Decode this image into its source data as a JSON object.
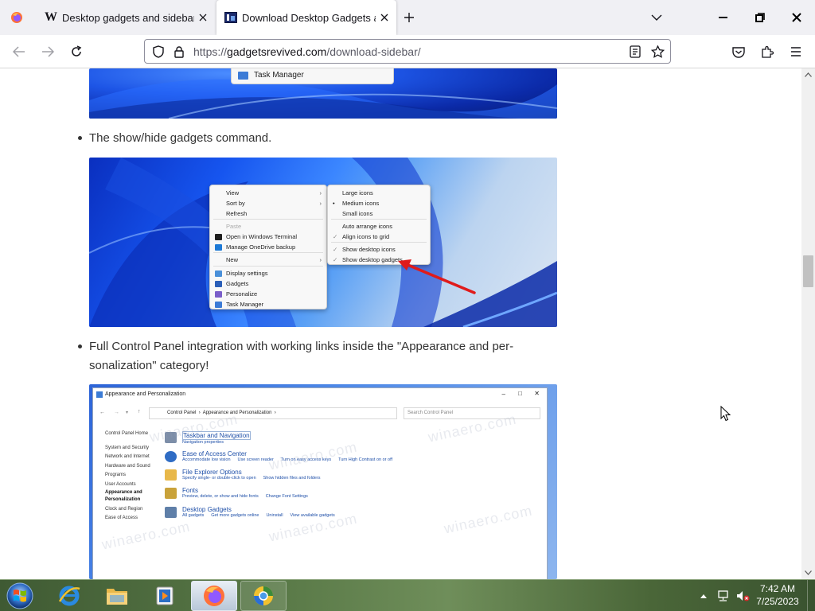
{
  "browser": {
    "tabs": [
      {
        "title": "Desktop gadgets and sidebar fo",
        "favicon": "W"
      },
      {
        "title": "Download Desktop Gadgets an"
      }
    ],
    "url_prefix": "https://",
    "url_host": "gadgetsrevived.com",
    "url_path": "/download-sidebar/"
  },
  "article": {
    "menu_top": {
      "task_manager": "Task Manager"
    },
    "bullet1": "The show/hide gadgets command.",
    "context_menu": {
      "items": [
        "View",
        "Sort by",
        "Refresh",
        "Paste",
        "Open in Windows Terminal",
        "Manage OneDrive backup",
        "New",
        "Display settings",
        "Gadgets",
        "Personalize",
        "Task Manager"
      ]
    },
    "view_submenu": {
      "items": [
        "Large icons",
        "Medium icons",
        "Small icons",
        "Auto arrange icons",
        "Align icons to grid",
        "Show desktop icons",
        "Show desktop gadgets"
      ]
    },
    "bullet2_line1": "Full Control Panel integration with working links inside the \"Appearance and per-",
    "bullet2_line2": "sonalization\" category!",
    "control_panel": {
      "title": "Appearance and Personalization",
      "breadcrumb": [
        "Control Panel",
        "Appearance and Personalization"
      ],
      "search_placeholder": "Search Control Panel",
      "sidebar": [
        "Control Panel Home",
        "System and Security",
        "Network and Internet",
        "Hardware and Sound",
        "Programs",
        "User Accounts",
        "Appearance and",
        "Personalization",
        "Clock and Region",
        "Ease of Access"
      ],
      "categories": [
        {
          "title": "Taskbar and Navigation",
          "links": [
            "Navigation properties"
          ]
        },
        {
          "title": "Ease of Access Center",
          "links": [
            "Accommodate low vision",
            "Use screen reader",
            "Turn on easy access keys",
            "Turn High Contrast on or off"
          ]
        },
        {
          "title": "File Explorer Options",
          "links": [
            "Specify single- or double-click to open",
            "Show hidden files and folders"
          ]
        },
        {
          "title": "Fonts",
          "links": [
            "Preview, delete, or show and hide fonts",
            "Change Font Settings"
          ]
        },
        {
          "title": "Desktop Gadgets",
          "links": [
            "All gadgets",
            "Get more gadgets online",
            "Uninstall",
            "View available gadgets"
          ]
        }
      ],
      "watermark": "winaero.com"
    }
  },
  "taskbar": {
    "time": "7:42 AM",
    "date": "7/25/2023"
  },
  "colors": {
    "accent": "#0060df",
    "arrow_red": "#e01b1b",
    "cp_link": "#1e4fa8"
  }
}
